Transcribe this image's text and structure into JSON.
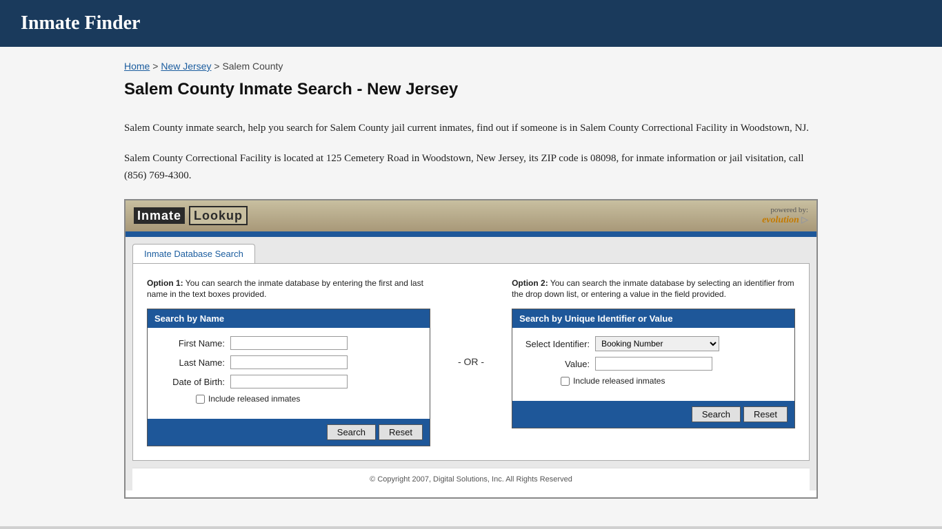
{
  "header": {
    "title": "Inmate Finder"
  },
  "breadcrumb": {
    "home": "Home",
    "state": "New Jersey",
    "county": "Salem County"
  },
  "page": {
    "title": "Salem County Inmate Search - New Jersey",
    "desc1": "Salem County inmate search, help you search for Salem County jail current inmates, find out if someone is in Salem County Correctional Facility in Woodstown, NJ.",
    "desc2": "Salem County Correctional Facility is located at 125 Cemetery Road in Woodstown, New Jersey, its ZIP code is 08098, for inmate information or jail visitation, call (856) 769-4300."
  },
  "widget": {
    "logo_inmate": "Inmate",
    "logo_lookup": "Lookup",
    "powered_by": "powered by:",
    "evolution": "evolution",
    "tab_label": "Inmate Database Search",
    "option1_label": "Option 1:",
    "option1_text": " You can search the inmate database by entering the first and last name in the text boxes provided.",
    "or_text": "- OR -",
    "option2_label": "Option 2:",
    "option2_text": " You can search the inmate database by selecting an identifier from the drop down list, or entering a value in the field provided.",
    "search_by_name_header": "Search by Name",
    "first_name_label": "First Name:",
    "last_name_label": "Last Name:",
    "dob_label": "Date of Birth:",
    "include_released_left": "Include released inmates",
    "search_btn_left": "Search",
    "reset_btn_left": "Reset",
    "search_by_id_header": "Search by Unique Identifier or Value",
    "select_identifier_label": "Select Identifier:",
    "identifier_option": "Booking Number",
    "value_label": "Value:",
    "include_released_right": "Include released inmates",
    "search_btn_right": "Search",
    "reset_btn_right": "Reset",
    "copyright": "© Copyright 2007, Digital Solutions, Inc. All Rights Reserved"
  }
}
